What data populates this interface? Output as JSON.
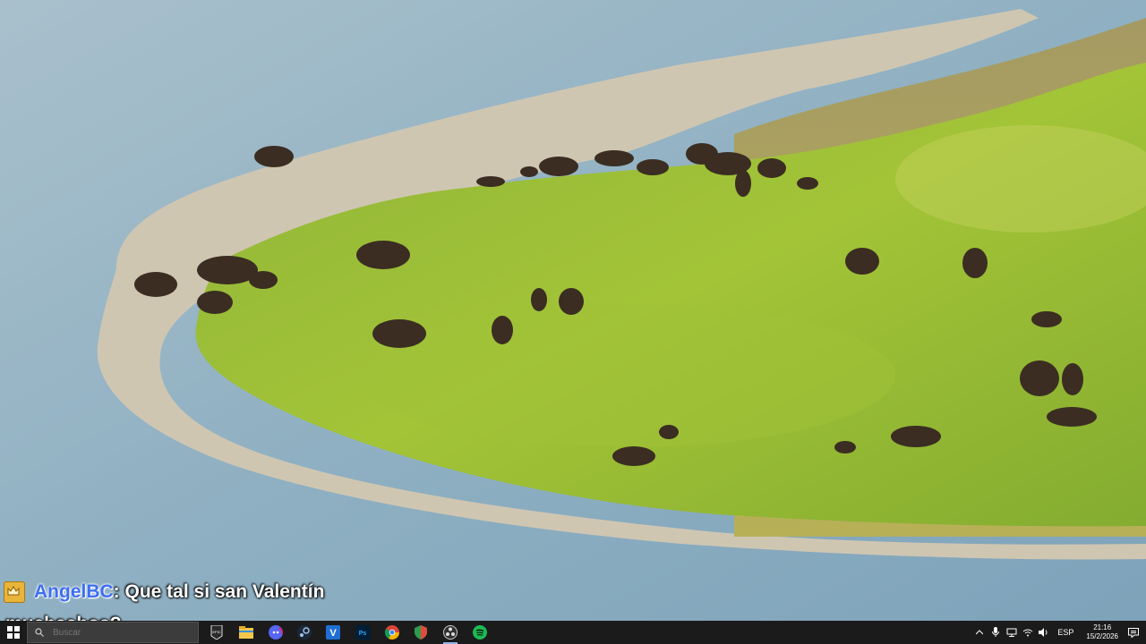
{
  "scene": {
    "description_icon": "bison-herd-river-photo"
  },
  "chat": {
    "badge_icon": "crown-badge-icon",
    "username": "AngelBC",
    "message_line1": " : Que tal si san Valentín",
    "message_line2": "muchachos?"
  },
  "taskbar": {
    "search_placeholder": "Buscar",
    "apps": [
      {
        "name": "epic-games-icon",
        "label": "EPIC"
      },
      {
        "name": "file-explorer-icon"
      },
      {
        "name": "discord-icon"
      },
      {
        "name": "steam-icon"
      },
      {
        "name": "vscode-icon",
        "label": "V"
      },
      {
        "name": "photoshop-icon",
        "label": "Ps"
      },
      {
        "name": "chrome-icon"
      },
      {
        "name": "shield-app-icon"
      },
      {
        "name": "obs-icon"
      },
      {
        "name": "spotify-icon"
      }
    ],
    "tray": {
      "language": "ESP",
      "time": "21:16",
      "date": "15/2/2026"
    }
  }
}
